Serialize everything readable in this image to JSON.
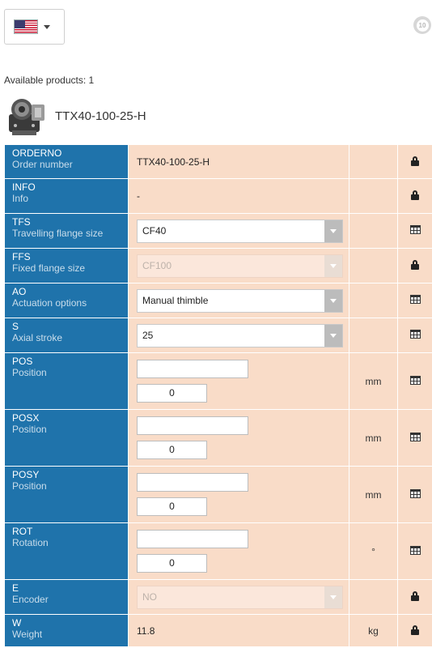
{
  "header": {
    "language_flag": "us-flag-icon",
    "brand_icon_label": "10"
  },
  "available_products": "Available products: 1",
  "product": {
    "name": "TTX40-100-25-H"
  },
  "colors": {
    "label_bg": "#1f73ab",
    "row_bg": "#f9dcc8",
    "label_desc": "#c9ddeb"
  },
  "rows": [
    {
      "code": "ORDERNO",
      "desc": "Order number",
      "value": "TTX40-100-25-H",
      "unit": "",
      "icon": "lock-icon"
    },
    {
      "code": "INFO",
      "desc": "Info",
      "value": "-",
      "unit": "",
      "icon": "lock-icon"
    },
    {
      "code": "TFS",
      "desc": "Travelling flange size",
      "value": "CF40",
      "unit": "",
      "icon": "table-icon"
    },
    {
      "code": "FFS",
      "desc": "Fixed flange size",
      "value": "CF100",
      "unit": "",
      "icon": "lock-icon"
    },
    {
      "code": "AO",
      "desc": "Actuation options",
      "value": "Manual thimble",
      "unit": "",
      "icon": "table-icon"
    },
    {
      "code": "S",
      "desc": "Axial stroke",
      "value": "25",
      "unit": "",
      "icon": "table-icon"
    },
    {
      "code": "POS",
      "desc": "Position",
      "text_value": "",
      "number_value": "0",
      "unit": "mm",
      "icon": "table-icon"
    },
    {
      "code": "POSX",
      "desc": "Position",
      "text_value": "",
      "number_value": "0",
      "unit": "mm",
      "icon": "table-icon"
    },
    {
      "code": "POSY",
      "desc": "Position",
      "text_value": "",
      "number_value": "0",
      "unit": "mm",
      "icon": "table-icon"
    },
    {
      "code": "ROT",
      "desc": "Rotation",
      "text_value": "",
      "number_value": "0",
      "unit": "°",
      "icon": "table-icon"
    },
    {
      "code": "E",
      "desc": "Encoder",
      "value": "NO",
      "unit": "",
      "icon": "lock-icon"
    },
    {
      "code": "W",
      "desc": "Weight",
      "value": "11.8",
      "unit": "kg",
      "icon": "lock-icon"
    }
  ]
}
